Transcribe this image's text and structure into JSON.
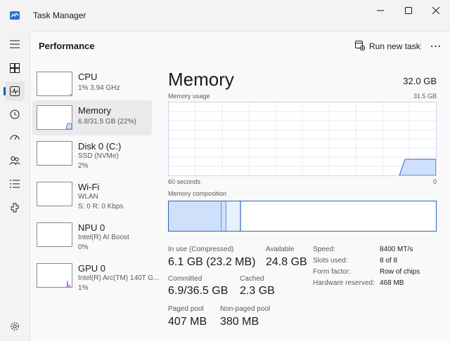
{
  "window": {
    "title": "Task Manager"
  },
  "colors": {
    "accent": "#005fb8",
    "memory_fill": "#cfe0fa",
    "memory_line": "#2f63b8",
    "gpu_line": "#a34cc8"
  },
  "nav": {
    "items": [
      {
        "name": "hamburger-icon"
      },
      {
        "name": "processes-icon"
      },
      {
        "name": "performance-icon",
        "active": true
      },
      {
        "name": "app-history-icon"
      },
      {
        "name": "startup-apps-icon"
      },
      {
        "name": "users-icon"
      },
      {
        "name": "details-icon"
      },
      {
        "name": "services-icon"
      },
      {
        "name": "settings-icon"
      }
    ]
  },
  "header": {
    "page_title": "Performance",
    "run_new_task": "Run new task",
    "more": "⋯"
  },
  "devices": [
    {
      "name": "CPU",
      "line1": "1% 3.94 GHz",
      "line2": ""
    },
    {
      "name": "Memory",
      "line1": "6.8/31.5 GB (22%)",
      "line2": "",
      "selected": true
    },
    {
      "name": "Disk 0 (C:)",
      "line1": "SSD (NVMe)",
      "line2": "2%"
    },
    {
      "name": "Wi-Fi",
      "line1": "WLAN",
      "line2": "S: 0 R: 0 Kbps"
    },
    {
      "name": "NPU 0",
      "line1": "Intel(R) AI Boost",
      "line2": "0%"
    },
    {
      "name": "GPU 0",
      "line1": "Intel(R) Arc(TM) 140T G...",
      "line2": "1%"
    }
  ],
  "detail": {
    "title": "Memory",
    "total": "32.0 GB",
    "usage_label": "Memory usage",
    "usage_max": "31.5 GB",
    "axis_left": "60 seconds",
    "axis_right": "0",
    "composition_label": "Memory composition",
    "stats": {
      "in_use_label": "In use (Compressed)",
      "in_use_value": "6.1 GB (23.2 MB)",
      "available_label": "Available",
      "available_value": "24.8 GB",
      "committed_label": "Committed",
      "committed_value": "6.9/36.5 GB",
      "cached_label": "Cached",
      "cached_value": "2.3 GB",
      "paged_label": "Paged pool",
      "paged_value": "407 MB",
      "nonpaged_label": "Non-paged pool",
      "nonpaged_value": "380 MB"
    },
    "specs": [
      {
        "label": "Speed:",
        "value": "8400 MT/s"
      },
      {
        "label": "Slots used:",
        "value": "8 of 8"
      },
      {
        "label": "Form factor:",
        "value": "Row of chips"
      },
      {
        "label": "Hardware reserved:",
        "value": "468 MB"
      }
    ]
  }
}
